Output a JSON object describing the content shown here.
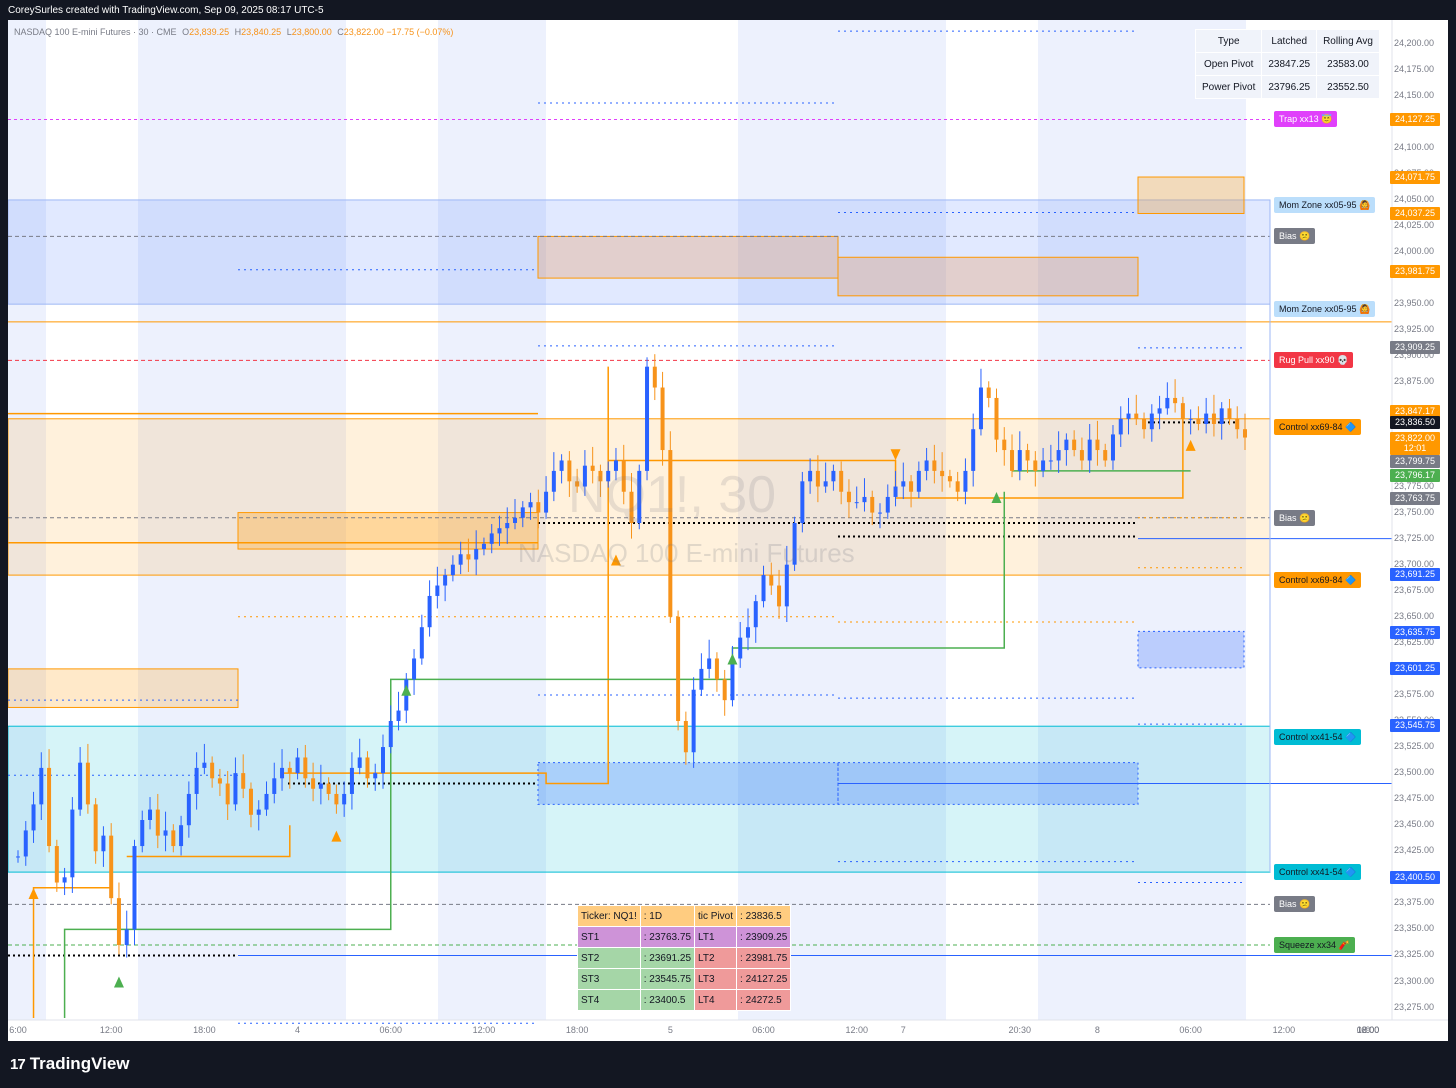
{
  "header": {
    "caption": "CoreySurles created with TradingView.com, Sep 09, 2025 08:17 UTC-5"
  },
  "legend": {
    "symbol": "NASDAQ 100 E-mini Futures · 30 · CME",
    "open_label": "O",
    "open": "23,839.25",
    "high_label": "H",
    "high": "23,840.25",
    "low_label": "L",
    "low": "23,800.00",
    "close_label": "C",
    "close": "23,822.00",
    "change": "−17.75 (−0.07%)"
  },
  "watermark": {
    "ticker": "NQ1!, 30",
    "name": "NASDAQ 100 E-mini Futures"
  },
  "pivot_table": {
    "headers": [
      "Type",
      "Latched",
      "Rolling Avg"
    ],
    "rows": [
      [
        "Open Pivot",
        "23847.25",
        "23583.00"
      ],
      [
        "Power Pivot",
        "23796.25",
        "23552.50"
      ]
    ]
  },
  "levels_table": {
    "header": [
      "Ticker: NQ1!",
      ": 1D",
      "tic Pivot",
      ": 23836.5"
    ],
    "rows": [
      [
        "ST1",
        ": 23763.75",
        "LT1",
        ": 23909.25"
      ],
      [
        "ST2",
        ": 23691.25",
        "LT2",
        ": 23981.75"
      ],
      [
        "ST3",
        ": 23545.75",
        "LT3",
        ": 24127.25"
      ],
      [
        "ST4",
        ": 23400.5",
        "LT4",
        ": 24272.5"
      ]
    ]
  },
  "tags": [
    {
      "text": "Trap xx13 😇",
      "price": 24127.25,
      "bg": "#e040fb",
      "fg": "#ffffff"
    },
    {
      "text": "Mom Zone xx05-95 🙆",
      "price": 24045,
      "bg": "#bbdefb",
      "fg": "#131722"
    },
    {
      "text": "Bias 😕",
      "price": 24015,
      "bg": "#787b86",
      "fg": "#ffffff"
    },
    {
      "text": "Mom Zone xx05-95 🙆",
      "price": 23945,
      "bg": "#bbdefb",
      "fg": "#131722"
    },
    {
      "text": "Rug Pull xx90 💀",
      "price": 23896,
      "bg": "#f23645",
      "fg": "#ffffff"
    },
    {
      "text": "Control xx69-84 🔷",
      "price": 23832,
      "bg": "#ff9800",
      "fg": "#131722"
    },
    {
      "text": "Bias 😕",
      "price": 23745,
      "bg": "#787b86",
      "fg": "#ffffff"
    },
    {
      "text": "Control xx69-84 🔷",
      "price": 23685,
      "bg": "#ff9800",
      "fg": "#131722"
    },
    {
      "text": "Control xx41-54 🔷",
      "price": 23535,
      "bg": "#00bcd4",
      "fg": "#131722"
    },
    {
      "text": "Control xx41-54 🔷",
      "price": 23405,
      "bg": "#00bcd4",
      "fg": "#131722"
    },
    {
      "text": "Bias 😕",
      "price": 23374,
      "bg": "#787b86",
      "fg": "#ffffff"
    },
    {
      "text": "Squeeze xx34 🧨",
      "price": 23335,
      "bg": "#4caf50",
      "fg": "#131722"
    }
  ],
  "price_labels": [
    {
      "text": "24,127.25",
      "price": 24127.25,
      "bg": "#ff9800"
    },
    {
      "text": "24,071.75",
      "price": 24071.75,
      "bg": "#ff9800"
    },
    {
      "text": "24,037.25",
      "price": 24037.25,
      "bg": "#ff9800"
    },
    {
      "text": "23,981.75",
      "price": 23981.75,
      "bg": "#ff9800"
    },
    {
      "text": "23,909.25",
      "price": 23909.25,
      "bg": "#787b86"
    },
    {
      "text": "23,847.17",
      "price": 23847.17,
      "bg": "#ff9800"
    },
    {
      "text": "23,836.50",
      "price": 23836.5,
      "bg": "#131722"
    },
    {
      "text": "23,822.00",
      "price": 23822.0,
      "bg": "#ff9800"
    },
    {
      "text": "12:01",
      "price": 23812,
      "bg": "#ff9800"
    },
    {
      "text": "23,799.75",
      "price": 23799.75,
      "bg": "#787b86"
    },
    {
      "text": "23,796.17",
      "price": 23786,
      "bg": "#4caf50"
    },
    {
      "text": "23,763.75",
      "price": 23763.75,
      "bg": "#787b86"
    },
    {
      "text": "23,691.25",
      "price": 23691.25,
      "bg": "#2962ff"
    },
    {
      "text": "23,635.75",
      "price": 23635.75,
      "bg": "#2962ff"
    },
    {
      "text": "23,601.25",
      "price": 23601.25,
      "bg": "#2962ff"
    },
    {
      "text": "23,545.75",
      "price": 23545.75,
      "bg": "#2962ff"
    },
    {
      "text": "23,400.50",
      "price": 23400.5,
      "bg": "#2962ff"
    }
  ],
  "chart_data": {
    "type": "candlestick",
    "symbol": "NQ1!",
    "interval": "30",
    "y_axis": {
      "ticks": [
        "24,200.00",
        "24,175.00",
        "24,150.00",
        "24,100.00",
        "24,075.00",
        "24,050.00",
        "24,025.00",
        "24,000.00",
        "23,950.00",
        "23,925.00",
        "23,900.00",
        "23,875.00",
        "23,775.00",
        "23,750.00",
        "23,725.00",
        "23,700.00",
        "23,675.00",
        "23,650.00",
        "23,625.00",
        "23,600.00",
        "23,575.00",
        "23,550.00",
        "23,525.00",
        "23,500.00",
        "23,475.00",
        "23,450.00",
        "23,425.00",
        "23,375.00",
        "23,350.00",
        "23,325.00",
        "23,300.00",
        "23,275.00"
      ],
      "range": [
        23265,
        24215
      ]
    },
    "x_axis": {
      "ticks": [
        "6:00",
        "12:00",
        "18:00",
        "4",
        "06:00",
        "12:00",
        "18:00",
        "5",
        "06:00",
        "12:00",
        "7",
        "20:30",
        "8",
        "06:00",
        "12:00",
        "18:00",
        "9",
        "06:00",
        "12:00",
        "18:00"
      ],
      "tick_bar_index": [
        0,
        12,
        24,
        36,
        48,
        60,
        72,
        84,
        96,
        108,
        114,
        129,
        139,
        151,
        163,
        175,
        187,
        199,
        211,
        223
      ]
    },
    "candle_colors": {
      "up": "#2962ff",
      "down": "#f7931a"
    },
    "closes": [
      23420,
      23445,
      23470,
      23505,
      23430,
      23395,
      23400,
      23465,
      23510,
      23470,
      23425,
      23440,
      23380,
      23335,
      23350,
      23430,
      23455,
      23465,
      23440,
      23445,
      23430,
      23450,
      23480,
      23505,
      23510,
      23495,
      23490,
      23470,
      23500,
      23485,
      23460,
      23465,
      23480,
      23495,
      23505,
      23500,
      23515,
      23495,
      23485,
      23490,
      23480,
      23470,
      23480,
      23505,
      23515,
      23495,
      23500,
      23525,
      23550,
      23560,
      23590,
      23610,
      23640,
      23670,
      23680,
      23690,
      23700,
      23710,
      23705,
      23715,
      23720,
      23730,
      23735,
      23740,
      23745,
      23755,
      23760,
      23750,
      23770,
      23790,
      23800,
      23780,
      23775,
      23795,
      23790,
      23780,
      23790,
      23800,
      23770,
      23740,
      23790,
      23890,
      23870,
      23810,
      23650,
      23550,
      23520,
      23580,
      23600,
      23610,
      23590,
      23570,
      23610,
      23630,
      23640,
      23665,
      23690,
      23680,
      23660,
      23700,
      23740,
      23780,
      23790,
      23775,
      23780,
      23790,
      23770,
      23760,
      23760,
      23765,
      23750,
      23750,
      23765,
      23775,
      23780,
      23770,
      23790,
      23800,
      23790,
      23785,
      23780,
      23770,
      23790,
      23830,
      23870,
      23860,
      23820,
      23810,
      23790,
      23810,
      23800,
      23790,
      23800,
      23800,
      23810,
      23820,
      23810,
      23800,
      23820,
      23810,
      23800,
      23825,
      23840,
      23845,
      23840,
      23830,
      23845,
      23850,
      23860,
      23855,
      23840,
      23840,
      23835,
      23845,
      23835,
      23850,
      23840,
      23830,
      23822
    ],
    "pivot_levels": {
      "tic_pivot": 23836.5,
      "ST1": 23763.75,
      "ST2": 23691.25,
      "ST3": 23545.75,
      "ST4": 23400.5,
      "LT1": 23909.25,
      "LT2": 23981.75,
      "LT3": 24127.25,
      "LT4": 24272.5
    }
  },
  "footer": {
    "brand": "TradingView"
  }
}
